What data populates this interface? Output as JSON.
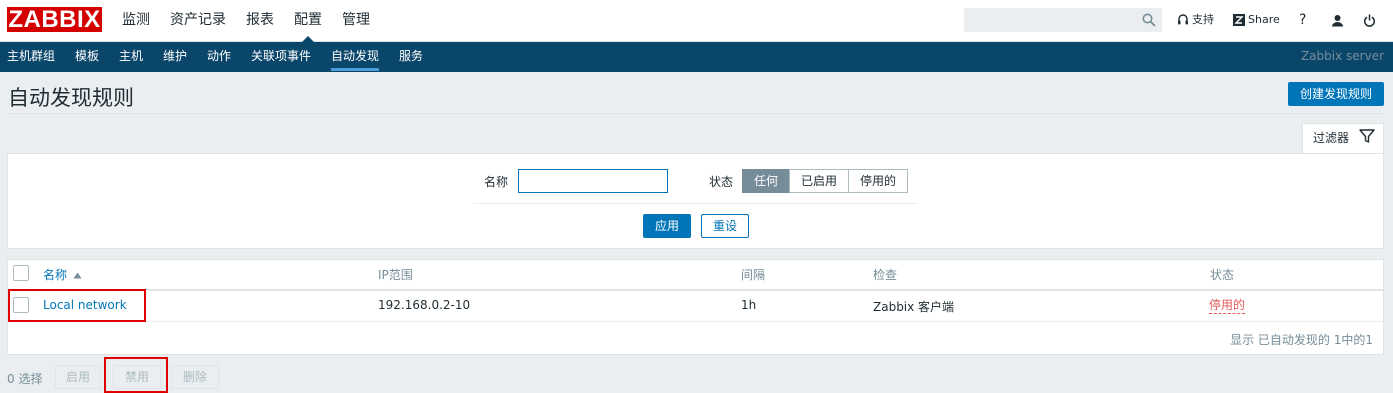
{
  "header": {
    "logo": "ZABBIX",
    "menu": [
      "监测",
      "资产记录",
      "报表",
      "配置",
      "管理"
    ],
    "selected_menu": "配置",
    "search": {
      "value": "",
      "placeholder": ""
    },
    "support_label": "支持",
    "share_label": "Share",
    "help_label": "?"
  },
  "subnav": {
    "items": [
      "主机群组",
      "模板",
      "主机",
      "维护",
      "动作",
      "关联项事件",
      "自动发现",
      "服务"
    ],
    "selected": "自动发现",
    "server_name": "Zabbix server"
  },
  "page": {
    "title": "自动发现规则",
    "create_button": "创建发现规则"
  },
  "filter": {
    "tab_label": "过滤器",
    "name_label": "名称",
    "name_value": "",
    "status_label": "状态",
    "status_options": [
      "任何",
      "已启用",
      "停用的"
    ],
    "status_selected": "任何",
    "apply_label": "应用",
    "reset_label": "重设"
  },
  "table": {
    "columns": [
      "名称",
      "IP范围",
      "间隔",
      "检查",
      "状态"
    ],
    "sort_column": "名称",
    "sort_dir": "asc",
    "rows": [
      {
        "name": "Local network",
        "ip_range": "192.168.0.2-10",
        "interval": "1h",
        "checks": "Zabbix 客户端",
        "status": "停用的"
      }
    ],
    "paging": "显示 已自动发现的 1中的1"
  },
  "footer": {
    "selected_count": "0 选择",
    "enable_label": "启用",
    "disable_label": "禁用",
    "delete_label": "删除"
  },
  "colors": {
    "brand": "#d40000",
    "nav": "#0a466a",
    "primary": "#0275b8",
    "status_disabled": "#e45959",
    "highlight": "#e00000"
  }
}
